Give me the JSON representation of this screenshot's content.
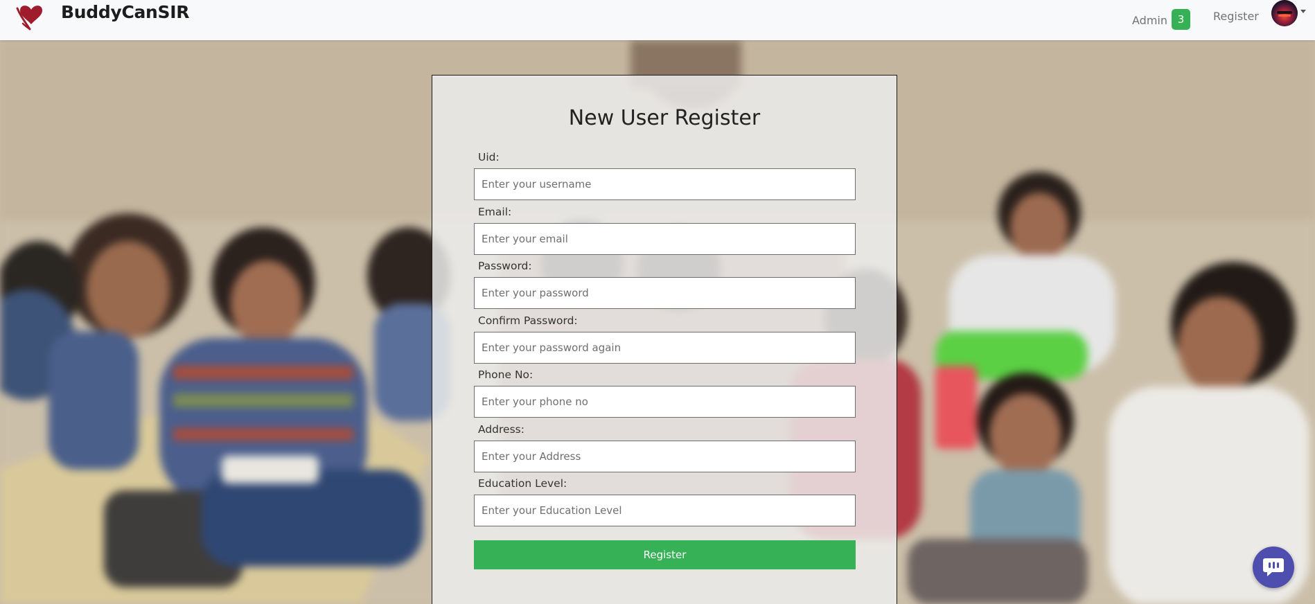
{
  "header": {
    "brand": "BuddyCanSIR",
    "nav": {
      "admin_label": "Admin",
      "admin_badge": "3",
      "register_label": "Register"
    }
  },
  "form": {
    "title": "New User Register",
    "fields": [
      {
        "label": "Uid:",
        "placeholder": "Enter your username"
      },
      {
        "label": "Email:",
        "placeholder": "Enter your email"
      },
      {
        "label": "Password:",
        "placeholder": "Enter your password"
      },
      {
        "label": "Confirm Password:",
        "placeholder": "Enter your password again"
      },
      {
        "label": "Phone No:",
        "placeholder": "Enter your phone no"
      },
      {
        "label": "Address:",
        "placeholder": "Enter your Address"
      },
      {
        "label": "Education Level:",
        "placeholder": "Enter your Education Level"
      }
    ],
    "submit_label": "Register"
  },
  "colors": {
    "accent_green": "#36b156",
    "logo_red": "#9e1c2c",
    "chat_purple": "#4e4eae"
  },
  "icons": {
    "logo": "heart-hands-logo",
    "avatar": "user-avatar",
    "chat": "chat-bubble-icon"
  }
}
